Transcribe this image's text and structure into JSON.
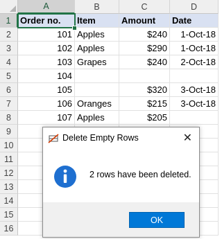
{
  "columns": [
    "A",
    "B",
    "C",
    "D"
  ],
  "row_numbers": [
    "1",
    "2",
    "3",
    "4",
    "5",
    "6",
    "7",
    "8",
    "9",
    "10",
    "11",
    "12",
    "13",
    "14",
    "15",
    "16"
  ],
  "header_row": [
    "Order no.",
    "Item",
    "Amount",
    "Date"
  ],
  "rows": [
    [
      "101",
      "Apples",
      "$240",
      "1-Oct-18"
    ],
    [
      "102",
      "Apples",
      "$290",
      "1-Oct-18"
    ],
    [
      "103",
      "Grapes",
      "$240",
      "2-Oct-18"
    ],
    [
      "104",
      "",
      "",
      ""
    ],
    [
      "105",
      "",
      "$320",
      "3-Oct-18"
    ],
    [
      "106",
      "Oranges",
      "$215",
      "3-Oct-18"
    ],
    [
      "107",
      "Apples",
      "$205",
      ""
    ]
  ],
  "dialog": {
    "title": "Delete Empty Rows",
    "message": "2 rows have been deleted.",
    "ok_label": "OK",
    "close_label": "✕",
    "title_icon": "delete-rows-icon",
    "body_icon": "info-icon",
    "accent": "#0078d7"
  },
  "colors": {
    "selection": "#217346",
    "header_fill": "#d9e1f2"
  }
}
